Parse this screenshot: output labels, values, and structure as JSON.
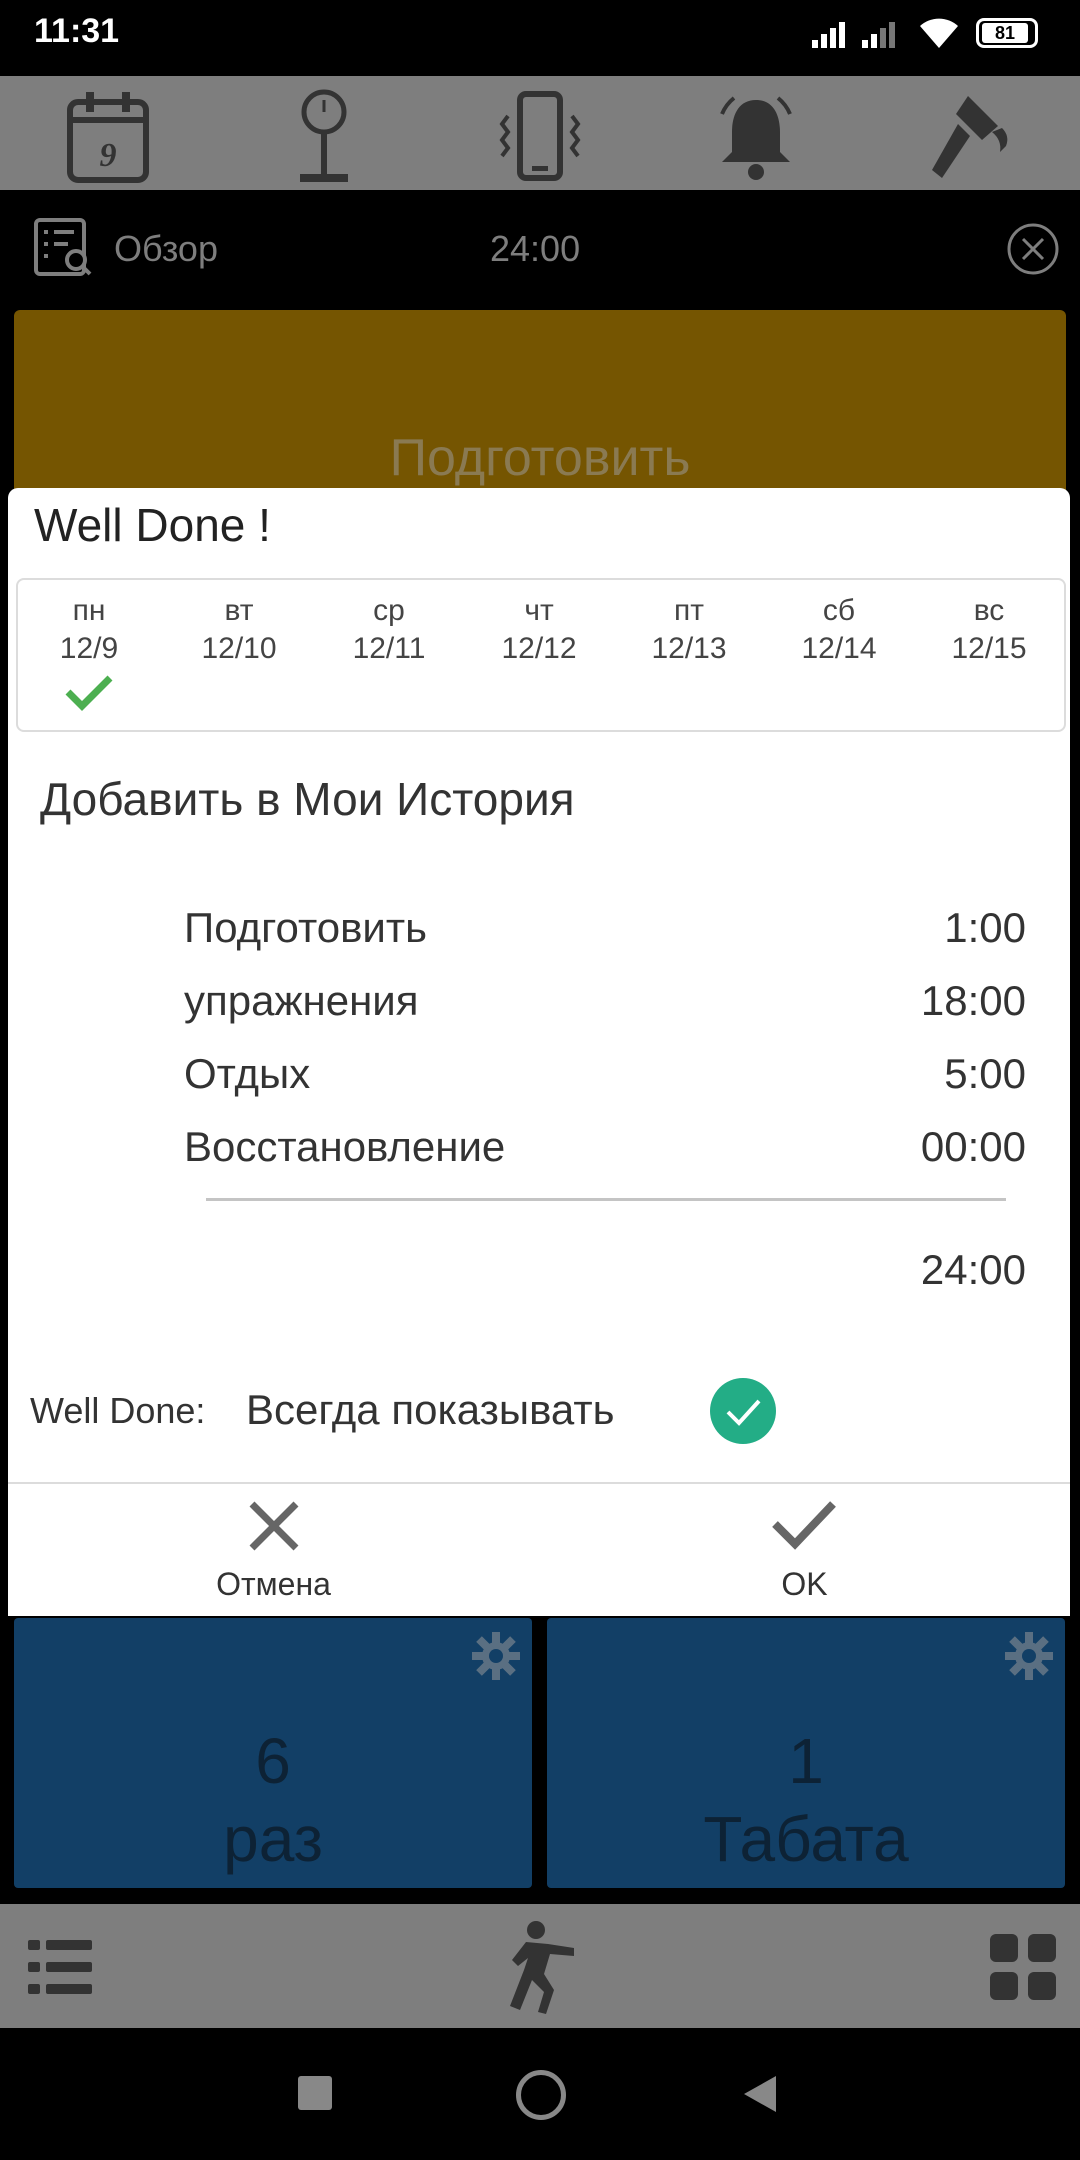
{
  "status_bar": {
    "time": "11:31",
    "battery": "81"
  },
  "toolbar": {
    "icons": [
      "calendar-icon",
      "scale-icon",
      "phone-vibrate-icon",
      "bell-icon",
      "paint-brush-icon"
    ],
    "calendar_day": "9"
  },
  "overview": {
    "label": "Обзор",
    "time": "24:00"
  },
  "background": {
    "prepare_label": "Подготовить",
    "rounds": {
      "number": "6",
      "label": "раз"
    },
    "tabata": {
      "number": "1",
      "label": "Табата"
    }
  },
  "dialog": {
    "title": "Well Done !",
    "week": [
      {
        "day": "пн",
        "date": "12/9",
        "done": true
      },
      {
        "day": "вт",
        "date": "12/10",
        "done": false
      },
      {
        "day": "ср",
        "date": "12/11",
        "done": false
      },
      {
        "day": "чт",
        "date": "12/12",
        "done": false
      },
      {
        "day": "пт",
        "date": "12/13",
        "done": false
      },
      {
        "day": "сб",
        "date": "12/14",
        "done": false
      },
      {
        "day": "вс",
        "date": "12/15",
        "done": false
      }
    ],
    "add_history": "Добавить в Мои История",
    "summary": [
      {
        "label": "Подготовить",
        "value": "1:00"
      },
      {
        "label": "упражнения",
        "value": "18:00"
      },
      {
        "label": "Отдых",
        "value": "5:00"
      },
      {
        "label": "Восстановление",
        "value": "00:00"
      }
    ],
    "total": "24:00",
    "well_done_label": "Well Done:",
    "well_done_option": "Всегда показывать",
    "well_done_enabled": true,
    "cancel_label": "Отмена",
    "ok_label": "OK"
  },
  "colors": {
    "accent_green": "#23ad86",
    "check_green": "#4caf50",
    "prepare_card": "#755501",
    "blue_card": "#123f66",
    "toolbar_gray": "#7e7e7e"
  }
}
